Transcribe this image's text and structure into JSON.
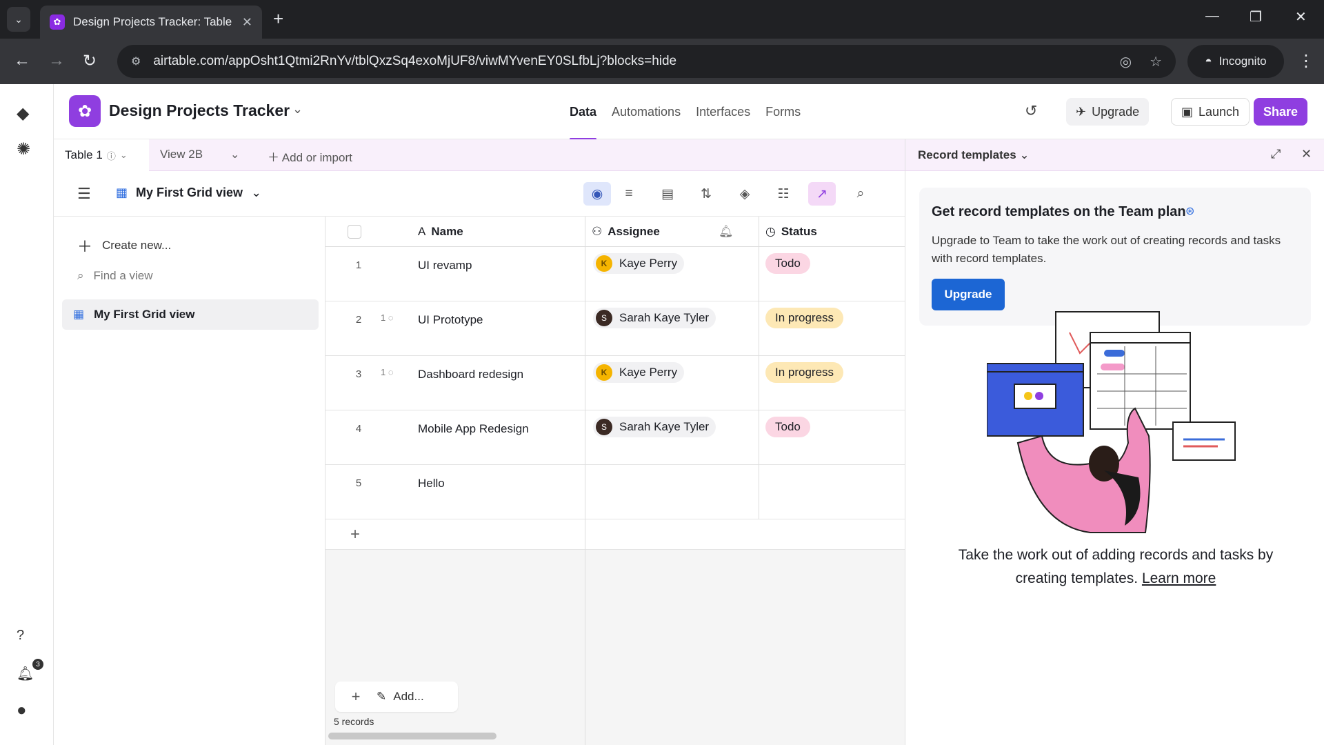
{
  "browser": {
    "tab_title": "Design Projects Tracker: Table 1",
    "url": "airtable.com/appOsht1Qtmi2RnYv/tblQxzSq4exoMjUF8/viwMYvenEY0SLfbLj?blocks=hide",
    "incognito_label": "Incognito"
  },
  "app": {
    "base_title": "Design Projects Tracker",
    "nav_tabs": [
      "Data",
      "Automations",
      "Interfaces",
      "Forms"
    ],
    "upgrade_label": "Upgrade",
    "launch_label": "Launch",
    "share_label": "Share"
  },
  "tablebar": {
    "active_table": "Table 1",
    "other_table": "View 2B",
    "add_label": "Add or import"
  },
  "view": {
    "name": "My First Grid view"
  },
  "sidebar": {
    "create_label": "Create new...",
    "find_placeholder": "Find a view",
    "views": [
      "My First Grid view"
    ]
  },
  "grid": {
    "columns": [
      "Name",
      "Assignee",
      "Status"
    ],
    "rows": [
      {
        "num": "1",
        "comments": "",
        "name": "UI revamp",
        "assignee": "Kaye Perry",
        "avatar": "K",
        "status": "Todo"
      },
      {
        "num": "2",
        "comments": "1",
        "name": "UI Prototype",
        "assignee": "Sarah Kaye Tyler",
        "avatar": "S",
        "status": "In progress"
      },
      {
        "num": "3",
        "comments": "1",
        "name": "Dashboard redesign",
        "assignee": "Kaye Perry",
        "avatar": "K",
        "status": "In progress"
      },
      {
        "num": "4",
        "comments": "",
        "name": "Mobile App Redesign",
        "assignee": "Sarah Kaye Tyler",
        "avatar": "S",
        "status": "Todo"
      },
      {
        "num": "5",
        "comments": "",
        "name": "Hello",
        "assignee": "",
        "avatar": "",
        "status": ""
      }
    ],
    "add_label": "Add...",
    "record_count": "5 records"
  },
  "panel": {
    "title": "Record templates",
    "promo_title": "Get record templates on the Team plan",
    "promo_text": "Upgrade to Team to take the work out of creating records and tasks with record templates.",
    "promo_button": "Upgrade",
    "caption": "Take the work out of adding records and tasks by creating templates.",
    "learn_more": "Learn more"
  },
  "notifications": {
    "count": "3"
  },
  "colors": {
    "accent": "#8f3ee0",
    "todo_pill": "#fbd6e3",
    "inprogress_pill": "#fde8b5",
    "primary_blue": "#1c66d4"
  }
}
